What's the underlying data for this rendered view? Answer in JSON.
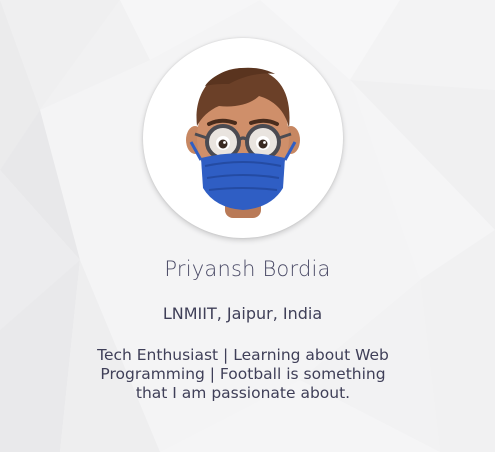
{
  "profile": {
    "avatar": "memoji-avatar-with-mask",
    "name": "Priyansh Bordia",
    "location": "LNMIIT, Jaipur, India",
    "bio": "Tech Enthusiast | Learning about Web Programming | Football is something that I am passionate about."
  },
  "colors": {
    "background": "#f3f3f4",
    "text": "#3f3f58",
    "mask": "#2f5ec4",
    "hair": "#6b4028"
  }
}
